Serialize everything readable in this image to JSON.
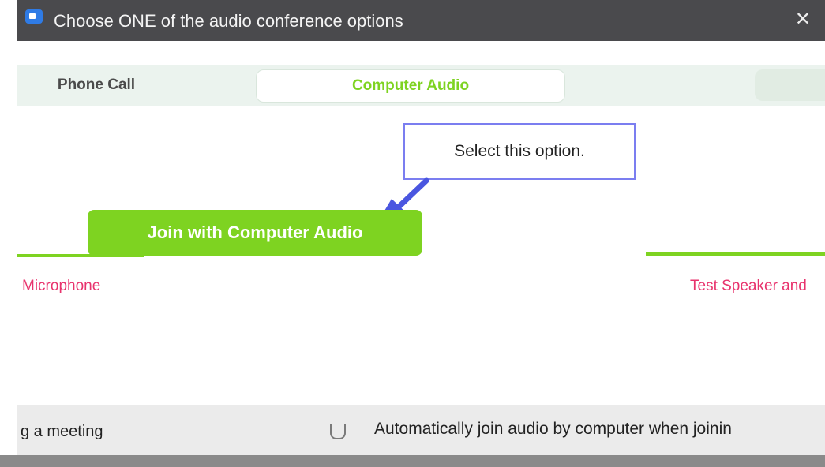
{
  "window": {
    "title": "Choose ONE of the audio conference options",
    "close_glyph": "✕",
    "app_icon": "camera-icon"
  },
  "tabs": [
    {
      "label": "Phone Call",
      "active": false
    },
    {
      "label": "Computer Audio",
      "active": true
    },
    {
      "label": "",
      "active": false
    }
  ],
  "callout": {
    "text": "Select this option."
  },
  "join_button": {
    "label": "Join with Computer Audio",
    "color": "#7ed321"
  },
  "links": {
    "microphone": "Microphone",
    "speaker": "Test Speaker and"
  },
  "footer": {
    "left_text": "g a meeting",
    "auto_join": {
      "label": "Automatically join audio by computer when joinin",
      "checked": false
    }
  },
  "colors": {
    "accent_green": "#7ed321",
    "link_pink": "#e8336d",
    "callout_border": "#7b7ef0",
    "titlebar": "#4a4a4d"
  }
}
